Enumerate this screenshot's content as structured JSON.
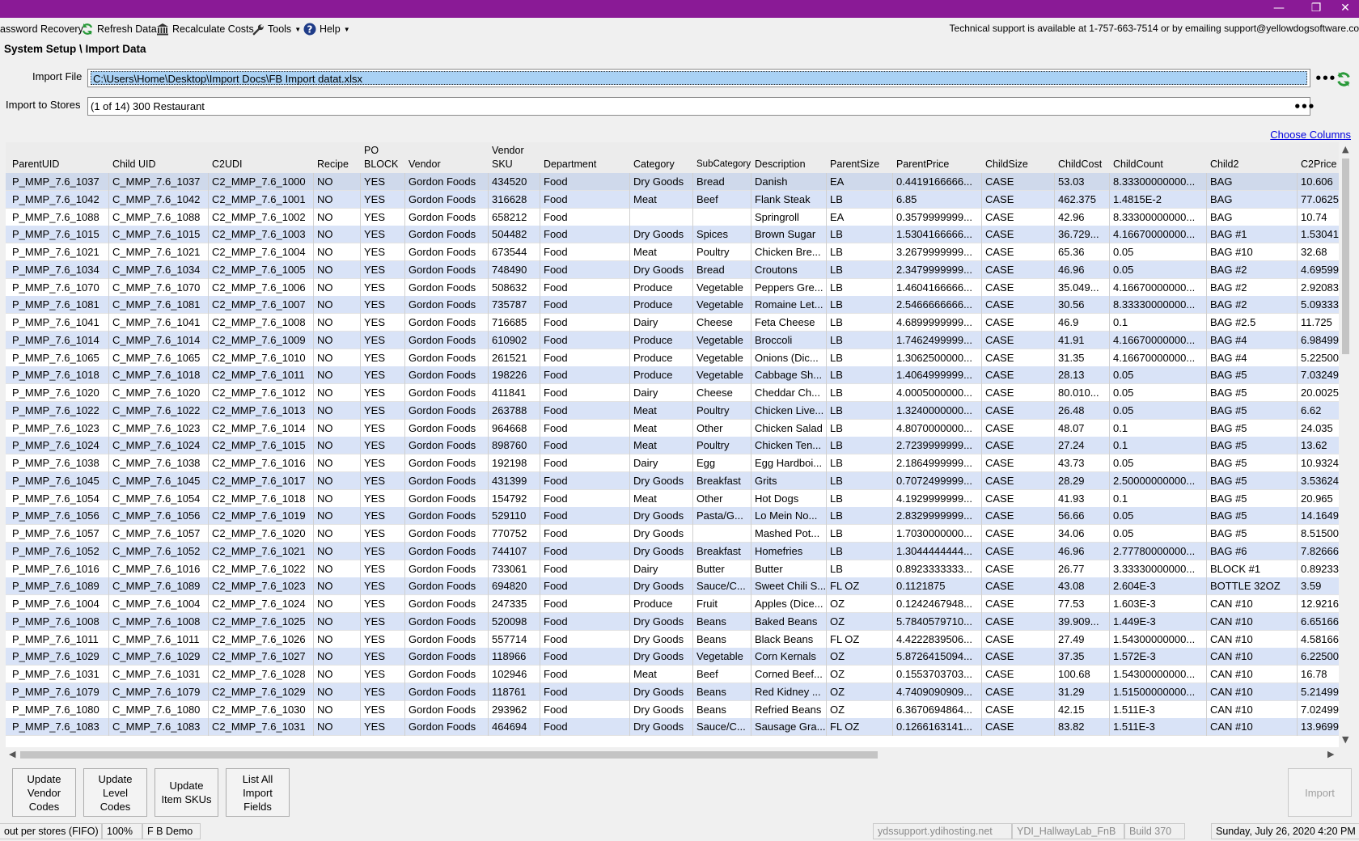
{
  "window": {
    "minimize": "—",
    "restore": "❐",
    "close": "✕"
  },
  "menu": {
    "password_recovery": "assword Recovery",
    "refresh": "Refresh Data",
    "recalculate": "Recalculate Costs",
    "tools": "Tools",
    "help": "Help"
  },
  "support_text": "Technical support is available at 1-757-663-7514 or by emailing support@yellowdogsoftware.co",
  "breadcrumb": "System Setup \\ Import Data",
  "import_file": {
    "label": "Import File",
    "value": "C:\\Users\\Home\\Desktop\\Import Docs\\FB Import datat.xlsx"
  },
  "import_stores": {
    "label": "Import to Stores",
    "value": "(1 of 14) 300 Restaurant"
  },
  "choose_columns": "Choose Columns",
  "grid": {
    "columns": [
      "ParentUID",
      "Child UID",
      "C2UDI",
      "Recipe",
      "PO\nBLOCK",
      "Vendor",
      "Vendor\nSKU",
      "Department",
      "Category",
      "SubCategory",
      "Description",
      "ParentSize",
      "ParentPrice",
      "ChildSize",
      "ChildCost",
      "ChildCount",
      "Child2",
      "C2Price"
    ],
    "rows": [
      [
        "P_MMP_7.6_1037",
        "C_MMP_7.6_1037",
        "C2_MMP_7.6_1000",
        "NO",
        "YES",
        "Gordon Foods",
        "434520",
        "Food",
        "Dry Goods",
        "Bread",
        "Danish",
        "EA",
        "0.4419166666...",
        "CASE",
        "53.03",
        "8.33300000000...",
        "BAG",
        "10.606"
      ],
      [
        "P_MMP_7.6_1042",
        "C_MMP_7.6_1042",
        "C2_MMP_7.6_1001",
        "NO",
        "YES",
        "Gordon Foods",
        "316628",
        "Food",
        "Meat",
        "Beef",
        "Flank Steak",
        "LB",
        "6.85",
        "CASE",
        "462.375",
        "1.4815E-2",
        "BAG",
        "77.0625"
      ],
      [
        "P_MMP_7.6_1088",
        "C_MMP_7.6_1088",
        "C2_MMP_7.6_1002",
        "NO",
        "YES",
        "Gordon Foods",
        "658212",
        "Food",
        "",
        "",
        "Springroll",
        "EA",
        "0.3579999999...",
        "CASE",
        "42.96",
        "8.33300000000...",
        "BAG",
        "10.74"
      ],
      [
        "P_MMP_7.6_1015",
        "C_MMP_7.6_1015",
        "C2_MMP_7.6_1003",
        "NO",
        "YES",
        "Gordon Foods",
        "504482",
        "Food",
        "Dry Goods",
        "Spices",
        "Brown Sugar",
        "LB",
        "1.5304166666...",
        "CASE",
        "36.729...",
        "4.16670000000...",
        "BAG #1",
        "1.53041"
      ],
      [
        "P_MMP_7.6_1021",
        "C_MMP_7.6_1021",
        "C2_MMP_7.6_1004",
        "NO",
        "YES",
        "Gordon Foods",
        "673544",
        "Food",
        "Meat",
        "Poultry",
        "Chicken Bre...",
        "LB",
        "3.2679999999...",
        "CASE",
        "65.36",
        "0.05",
        "BAG #10",
        "32.68"
      ],
      [
        "P_MMP_7.6_1034",
        "C_MMP_7.6_1034",
        "C2_MMP_7.6_1005",
        "NO",
        "YES",
        "Gordon Foods",
        "748490",
        "Food",
        "Dry Goods",
        "Bread",
        "Croutons",
        "LB",
        "2.3479999999...",
        "CASE",
        "46.96",
        "0.05",
        "BAG #2",
        "4.69599"
      ],
      [
        "P_MMP_7.6_1070",
        "C_MMP_7.6_1070",
        "C2_MMP_7.6_1006",
        "NO",
        "YES",
        "Gordon Foods",
        "508632",
        "Food",
        "Produce",
        "Vegetable",
        "Peppers Gre...",
        "LB",
        "1.4604166666...",
        "CASE",
        "35.049...",
        "4.16670000000...",
        "BAG #2",
        "2.92083"
      ],
      [
        "P_MMP_7.6_1081",
        "C_MMP_7.6_1081",
        "C2_MMP_7.6_1007",
        "NO",
        "YES",
        "Gordon Foods",
        "735787",
        "Food",
        "Produce",
        "Vegetable",
        "Romaine Let...",
        "LB",
        "2.5466666666...",
        "CASE",
        "30.56",
        "8.33330000000...",
        "BAG #2",
        "5.09333"
      ],
      [
        "P_MMP_7.6_1041",
        "C_MMP_7.6_1041",
        "C2_MMP_7.6_1008",
        "NO",
        "YES",
        "Gordon Foods",
        "716685",
        "Food",
        "Dairy",
        "Cheese",
        "Feta Cheese",
        "LB",
        "4.6899999999...",
        "CASE",
        "46.9",
        "0.1",
        "BAG #2.5",
        "11.725"
      ],
      [
        "P_MMP_7.6_1014",
        "C_MMP_7.6_1014",
        "C2_MMP_7.6_1009",
        "NO",
        "YES",
        "Gordon Foods",
        "610902",
        "Food",
        "Produce",
        "Vegetable",
        "Broccoli",
        "LB",
        "1.7462499999...",
        "CASE",
        "41.91",
        "4.16670000000...",
        "BAG #4",
        "6.98499"
      ],
      [
        "P_MMP_7.6_1065",
        "C_MMP_7.6_1065",
        "C2_MMP_7.6_1010",
        "NO",
        "YES",
        "Gordon Foods",
        "261521",
        "Food",
        "Produce",
        "Vegetable",
        "Onions (Dic...",
        "LB",
        "1.3062500000...",
        "CASE",
        "31.35",
        "4.16670000000...",
        "BAG #4",
        "5.22500"
      ],
      [
        "P_MMP_7.6_1018",
        "C_MMP_7.6_1018",
        "C2_MMP_7.6_1011",
        "NO",
        "YES",
        "Gordon Foods",
        "198226",
        "Food",
        "Produce",
        "Vegetable",
        "Cabbage Sh...",
        "LB",
        "1.4064999999...",
        "CASE",
        "28.13",
        "0.05",
        "BAG #5",
        "7.03249"
      ],
      [
        "P_MMP_7.6_1020",
        "C_MMP_7.6_1020",
        "C2_MMP_7.6_1012",
        "NO",
        "YES",
        "Gordon Foods",
        "411841",
        "Food",
        "Dairy",
        "Cheese",
        "Cheddar Ch...",
        "LB",
        "4.0005000000...",
        "CASE",
        "80.010...",
        "0.05",
        "BAG #5",
        "20.0025"
      ],
      [
        "P_MMP_7.6_1022",
        "C_MMP_7.6_1022",
        "C2_MMP_7.6_1013",
        "NO",
        "YES",
        "Gordon Foods",
        "263788",
        "Food",
        "Meat",
        "Poultry",
        "Chicken Live...",
        "LB",
        "1.3240000000...",
        "CASE",
        "26.48",
        "0.05",
        "BAG #5",
        "6.62"
      ],
      [
        "P_MMP_7.6_1023",
        "C_MMP_7.6_1023",
        "C2_MMP_7.6_1014",
        "NO",
        "YES",
        "Gordon Foods",
        "964668",
        "Food",
        "Meat",
        "Other",
        "Chicken Salad",
        "LB",
        "4.8070000000...",
        "CASE",
        "48.07",
        "0.1",
        "BAG #5",
        "24.035"
      ],
      [
        "P_MMP_7.6_1024",
        "C_MMP_7.6_1024",
        "C2_MMP_7.6_1015",
        "NO",
        "YES",
        "Gordon Foods",
        "898760",
        "Food",
        "Meat",
        "Poultry",
        "Chicken Ten...",
        "LB",
        "2.7239999999...",
        "CASE",
        "27.24",
        "0.1",
        "BAG #5",
        "13.62"
      ],
      [
        "P_MMP_7.6_1038",
        "C_MMP_7.6_1038",
        "C2_MMP_7.6_1016",
        "NO",
        "YES",
        "Gordon Foods",
        "192198",
        "Food",
        "Dairy",
        "Egg",
        "Egg Hardboi...",
        "LB",
        "2.1864999999...",
        "CASE",
        "43.73",
        "0.05",
        "BAG #5",
        "10.9324"
      ],
      [
        "P_MMP_7.6_1045",
        "C_MMP_7.6_1045",
        "C2_MMP_7.6_1017",
        "NO",
        "YES",
        "Gordon Foods",
        "431399",
        "Food",
        "Dry Goods",
        "Breakfast",
        "Grits",
        "LB",
        "0.7072499999...",
        "CASE",
        "28.29",
        "2.50000000000...",
        "BAG #5",
        "3.53624"
      ],
      [
        "P_MMP_7.6_1054",
        "C_MMP_7.6_1054",
        "C2_MMP_7.6_1018",
        "NO",
        "YES",
        "Gordon Foods",
        "154792",
        "Food",
        "Meat",
        "Other",
        "Hot Dogs",
        "LB",
        "4.1929999999...",
        "CASE",
        "41.93",
        "0.1",
        "BAG #5",
        "20.965"
      ],
      [
        "P_MMP_7.6_1056",
        "C_MMP_7.6_1056",
        "C2_MMP_7.6_1019",
        "NO",
        "YES",
        "Gordon Foods",
        "529110",
        "Food",
        "Dry Goods",
        "Pasta/G...",
        "Lo Mein No...",
        "LB",
        "2.8329999999...",
        "CASE",
        "56.66",
        "0.05",
        "BAG #5",
        "14.1649"
      ],
      [
        "P_MMP_7.6_1057",
        "C_MMP_7.6_1057",
        "C2_MMP_7.6_1020",
        "NO",
        "YES",
        "Gordon Foods",
        "770752",
        "Food",
        "Dry Goods",
        "",
        "Mashed Pot...",
        "LB",
        "1.7030000000...",
        "CASE",
        "34.06",
        "0.05",
        "BAG #5",
        "8.51500"
      ],
      [
        "P_MMP_7.6_1052",
        "C_MMP_7.6_1052",
        "C2_MMP_7.6_1021",
        "NO",
        "YES",
        "Gordon Foods",
        "744107",
        "Food",
        "Dry Goods",
        "Breakfast",
        "Homefries",
        "LB",
        "1.3044444444...",
        "CASE",
        "46.96",
        "2.77780000000...",
        "BAG #6",
        "7.82666"
      ],
      [
        "P_MMP_7.6_1016",
        "C_MMP_7.6_1016",
        "C2_MMP_7.6_1022",
        "NO",
        "YES",
        "Gordon Foods",
        "733061",
        "Food",
        "Dairy",
        "Butter",
        "Butter",
        "LB",
        "0.8923333333...",
        "CASE",
        "26.77",
        "3.33330000000...",
        "BLOCK #1",
        "0.89233"
      ],
      [
        "P_MMP_7.6_1089",
        "C_MMP_7.6_1089",
        "C2_MMP_7.6_1023",
        "NO",
        "YES",
        "Gordon Foods",
        "694820",
        "Food",
        "Dry Goods",
        "Sauce/C...",
        "Sweet Chili S...",
        "FL OZ",
        "0.1121875",
        "CASE",
        "43.08",
        "2.604E-3",
        "BOTTLE 32OZ",
        "3.59"
      ],
      [
        "P_MMP_7.6_1004",
        "C_MMP_7.6_1004",
        "C2_MMP_7.6_1024",
        "NO",
        "YES",
        "Gordon Foods",
        "247335",
        "Food",
        "Produce",
        "Fruit",
        "Apples (Dice...",
        "OZ",
        "0.1242467948...",
        "CASE",
        "77.53",
        "1.603E-3",
        "CAN #10",
        "12.9216"
      ],
      [
        "P_MMP_7.6_1008",
        "C_MMP_7.6_1008",
        "C2_MMP_7.6_1025",
        "NO",
        "YES",
        "Gordon Foods",
        "520098",
        "Food",
        "Dry Goods",
        "Beans",
        "Baked Beans",
        "OZ",
        "5.7840579710...",
        "CASE",
        "39.909...",
        "1.449E-3",
        "CAN #10",
        "6.65166"
      ],
      [
        "P_MMP_7.6_1011",
        "C_MMP_7.6_1011",
        "C2_MMP_7.6_1026",
        "NO",
        "YES",
        "Gordon Foods",
        "557714",
        "Food",
        "Dry Goods",
        "Beans",
        "Black Beans",
        "FL OZ",
        "4.4222839506...",
        "CASE",
        "27.49",
        "1.54300000000...",
        "CAN #10",
        "4.58166"
      ],
      [
        "P_MMP_7.6_1029",
        "C_MMP_7.6_1029",
        "C2_MMP_7.6_1027",
        "NO",
        "YES",
        "Gordon Foods",
        "118966",
        "Food",
        "Dry Goods",
        "Vegetable",
        "Corn Kernals",
        "OZ",
        "5.8726415094...",
        "CASE",
        "37.35",
        "1.572E-3",
        "CAN #10",
        "6.22500"
      ],
      [
        "P_MMP_7.6_1031",
        "C_MMP_7.6_1031",
        "C2_MMP_7.6_1028",
        "NO",
        "YES",
        "Gordon Foods",
        "102946",
        "Food",
        "Meat",
        "Beef",
        "Corned Beef...",
        "OZ",
        "0.1553703703...",
        "CASE",
        "100.68",
        "1.54300000000...",
        "CAN #10",
        "16.78"
      ],
      [
        "P_MMP_7.6_1079",
        "C_MMP_7.6_1079",
        "C2_MMP_7.6_1029",
        "NO",
        "YES",
        "Gordon Foods",
        "118761",
        "Food",
        "Dry Goods",
        "Beans",
        "Red Kidney ...",
        "OZ",
        "4.7409090909...",
        "CASE",
        "31.29",
        "1.51500000000...",
        "CAN #10",
        "5.21499"
      ],
      [
        "P_MMP_7.6_1080",
        "C_MMP_7.6_1080",
        "C2_MMP_7.6_1030",
        "NO",
        "YES",
        "Gordon Foods",
        "293962",
        "Food",
        "Dry Goods",
        "Beans",
        "Refried Beans",
        "OZ",
        "6.3670694864...",
        "CASE",
        "42.15",
        "1.511E-3",
        "CAN #10",
        "7.02499"
      ],
      [
        "P_MMP_7.6_1083",
        "C_MMP_7.6_1083",
        "C2_MMP_7.6_1031",
        "NO",
        "YES",
        "Gordon Foods",
        "464694",
        "Food",
        "Dry Goods",
        "Sauce/C...",
        "Sausage Gra...",
        "FL OZ",
        "0.1266163141...",
        "CASE",
        "83.82",
        "1.511E-3",
        "CAN #10",
        "13.9699"
      ]
    ]
  },
  "actions": {
    "update_vendor_codes": "Update\nVendor\nCodes",
    "update_level_codes": "Update\nLevel\nCodes",
    "update_item_skus": "Update\nItem SKUs",
    "list_import_fields": "List All\nImport\nFields",
    "import": "Import"
  },
  "statusbar": {
    "costing": "out per stores (FIFO)",
    "zoom": "100%",
    "company": "F B Demo",
    "host": "ydssupport.ydihosting.net",
    "database": "YDI_HallwayLab_FnB",
    "build": "Build 370",
    "datetime": "Sunday, July 26, 2020 4:20 PM"
  },
  "colors": {
    "titlebar": "#8a1a96",
    "row_alt": "#d9e3f7",
    "selection": "#a9d1f4",
    "link": "#0000dd"
  }
}
